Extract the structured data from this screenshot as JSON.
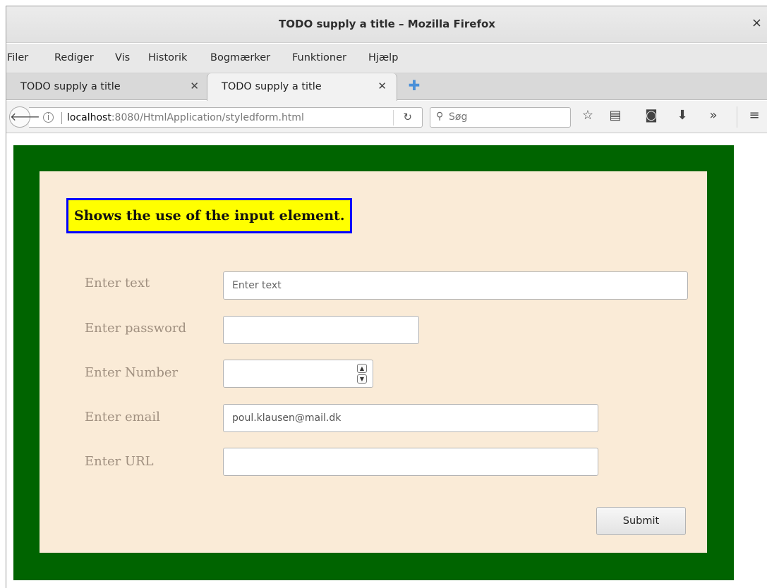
{
  "window": {
    "title": "TODO supply a title – Mozilla Firefox",
    "close_glyph": "×"
  },
  "menu": {
    "items": [
      "Filer",
      "Rediger",
      "Vis",
      "Historik",
      "Bogmærker",
      "Funktioner",
      "Hjælp"
    ]
  },
  "tabs": [
    {
      "label": "TODO supply a title",
      "active": false
    },
    {
      "label": "TODO supply a title",
      "active": true
    }
  ],
  "navbar": {
    "url_host": "localhost",
    "url_rest": ":8080/HtmlApplication/styledform.html",
    "search_placeholder": "Søg",
    "icons": [
      "back-icon",
      "info-icon",
      "reload-icon",
      "search-icon",
      "bookmark-star-icon",
      "reader-view-icon",
      "pocket-icon",
      "download-icon",
      "overflow-icon",
      "hamburger-menu-icon"
    ]
  },
  "page": {
    "heading": "Shows the use of the input element.",
    "colors": {
      "outer_bg": "#006400",
      "inner_bg": "#faebd7",
      "heading_bg": "#ffff00",
      "heading_border": "#0000ff",
      "label_color": "#a09080"
    },
    "fields": {
      "text": {
        "label": "Enter text",
        "placeholder": "Enter text",
        "value": ""
      },
      "password": {
        "label": "Enter password",
        "value": ""
      },
      "number": {
        "label": "Enter Number",
        "value": ""
      },
      "email": {
        "label": "Enter email",
        "value": "poul.klausen@mail.dk"
      },
      "url": {
        "label": "Enter URL",
        "value": ""
      }
    },
    "submit_label": "Submit"
  }
}
